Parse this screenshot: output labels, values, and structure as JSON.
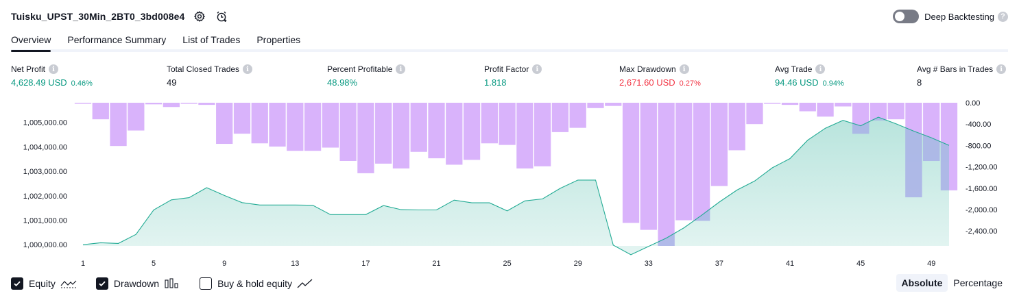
{
  "header": {
    "strategy_name": "Tuisku_UPST_30Min_2BT0_3bd008e4",
    "icons": [
      "settings-gear-icon",
      "add-alert-clock-icon"
    ],
    "deep_backtesting_label": "Deep Backtesting",
    "deep_backtesting_enabled": false,
    "help_glyph": "?"
  },
  "tabs": [
    {
      "label": "Overview",
      "active": true
    },
    {
      "label": "Performance Summary",
      "active": false
    },
    {
      "label": "List of Trades",
      "active": false
    },
    {
      "label": "Properties",
      "active": false
    }
  ],
  "metrics": {
    "info_glyph": "i",
    "net_profit": {
      "label": "Net Profit",
      "value": "4,628.49 USD",
      "pct": "0.46%"
    },
    "total_closed_trades": {
      "label": "Total Closed Trades",
      "value": "49"
    },
    "percent_profitable": {
      "label": "Percent Profitable",
      "value": "48.98%"
    },
    "profit_factor": {
      "label": "Profit Factor",
      "value": "1.818"
    },
    "max_drawdown": {
      "label": "Max Drawdown",
      "value": "2,671.60 USD",
      "pct": "0.27%"
    },
    "avg_trade": {
      "label": "Avg Trade",
      "value": "94.46 USD",
      "pct": "0.94%"
    },
    "avg_bars": {
      "label": "Avg # Bars in Trades",
      "value": "8"
    }
  },
  "colors": {
    "positive": "#089981",
    "negative": "#f23645",
    "equity_line": "#22ab94",
    "equity_fill": "#d8f0ea",
    "drawdown_bar": "#d9b3fb",
    "overlap_fill": "#aebbe8",
    "text": "#131722"
  },
  "chart_data": {
    "type": "area",
    "x_tick_labels": [
      "1",
      "5",
      "9",
      "13",
      "17",
      "21",
      "25",
      "29",
      "33",
      "37",
      "41",
      "45",
      "49"
    ],
    "left_axis": {
      "tick_labels": [
        "1,005,000.00",
        "1,004,000.00",
        "1,003,000.00",
        "1,002,000.00",
        "1,001,000.00",
        "1,000,000.00"
      ],
      "range": [
        999950,
        1005800
      ]
    },
    "right_axis": {
      "tick_labels": [
        "0.00",
        "-400.00",
        "-800.00",
        "-1,200.00",
        "-1,600.00",
        "-2,000.00",
        "-2,400.00"
      ],
      "range": [
        -2680,
        0
      ]
    },
    "series": [
      {
        "type": "area",
        "trade": [
          1,
          2,
          3,
          4,
          5,
          6,
          7,
          8,
          9,
          10,
          11,
          12,
          13,
          14,
          15,
          16,
          17,
          18,
          19,
          20,
          21,
          22,
          23,
          24,
          25,
          26,
          27,
          28,
          29,
          30,
          31,
          32,
          33,
          34,
          35,
          36,
          37,
          38,
          39,
          40,
          41,
          42,
          43,
          44,
          45,
          46,
          47,
          48,
          49,
          50
        ],
        "values": [
          1000000,
          1000080,
          1000050,
          1000420,
          1001420,
          1001830,
          1001920,
          1002330,
          1002010,
          1001720,
          1001620,
          1001620,
          1001620,
          1001610,
          1001230,
          1001230,
          1001230,
          1001600,
          1001430,
          1001420,
          1001420,
          1001820,
          1001710,
          1001710,
          1001380,
          1001790,
          1001870,
          1002300,
          1002640,
          1002640,
          999980,
          999590,
          999930,
          1000270,
          1000690,
          1001200,
          1001740,
          1002230,
          1002600,
          1003140,
          1003520,
          1004270,
          1004760,
          1005080,
          1004860,
          1005210,
          1004940,
          1004640,
          1004370,
          1004060
        ]
      },
      {
        "type": "bar",
        "trade": [
          1,
          2,
          3,
          4,
          5,
          6,
          7,
          8,
          9,
          10,
          11,
          12,
          13,
          14,
          15,
          16,
          17,
          18,
          19,
          20,
          21,
          22,
          23,
          24,
          25,
          26,
          27,
          28,
          29,
          30,
          31,
          32,
          33,
          34,
          35,
          36,
          37,
          38,
          39,
          40,
          41,
          42,
          43,
          44,
          45,
          46,
          47,
          48,
          49,
          50
        ],
        "values": [
          0,
          -310,
          -810,
          -520,
          -30,
          -80,
          0,
          -40,
          -770,
          -580,
          -760,
          -820,
          -900,
          -900,
          -840,
          -1090,
          -1320,
          -1140,
          -1230,
          -920,
          -1040,
          -1160,
          -1070,
          -760,
          -790,
          -1230,
          -1190,
          -550,
          -470,
          -100,
          -60,
          -2250,
          -2380,
          -2680,
          -2200,
          -2210,
          -1560,
          -890,
          -400,
          0,
          -40,
          -160,
          -260,
          -70,
          -580,
          -330,
          -310,
          -1770,
          -1090,
          -1640
        ]
      }
    ]
  },
  "legend": [
    {
      "label": "Equity",
      "checked": true,
      "icon": "equity-line-icon"
    },
    {
      "label": "Drawdown",
      "checked": true,
      "icon": "drawdown-bars-icon"
    },
    {
      "label": "Buy & hold equity",
      "checked": false,
      "icon": "buy-hold-line-icon"
    }
  ],
  "view_mode": {
    "options": [
      "Absolute",
      "Percentage"
    ],
    "active": "Absolute"
  }
}
